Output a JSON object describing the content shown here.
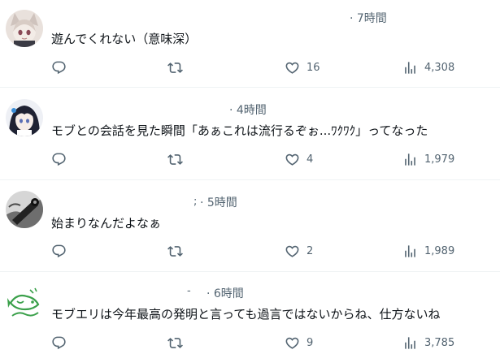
{
  "tweets": [
    {
      "time_label": "· 7時間",
      "text": "遊んでくれない（意味深）",
      "reply_count": "",
      "retweet_count": "",
      "like_count": "16",
      "view_count": "4,308",
      "avatar": "avatar-animal-ears-girl"
    },
    {
      "time_label": "· 4時間",
      "text": "モブとの会話を見た瞬間「あぁこれは流行るぞぉ...ﾜｸﾜｸ」ってなった",
      "reply_count": "",
      "retweet_count": "",
      "like_count": "4",
      "view_count": "1,979",
      "avatar": "avatar-dark-haired-girl"
    },
    {
      "time_label": "· 5時間",
      "text": "始まりなんだよなぁ",
      "reply_count": "",
      "retweet_count": "",
      "like_count": "2",
      "view_count": "1,989",
      "avatar": "avatar-monochrome-photo"
    },
    {
      "time_label": "· 6時間",
      "text": "モブエリは今年最高の発明と言っても過言ではないからね、仕方ないね",
      "reply_count": "",
      "retweet_count": "",
      "like_count": "9",
      "view_count": "3,785",
      "avatar": "avatar-green-fish-logo"
    }
  ],
  "name_fragments": [
    ";",
    "-"
  ],
  "icons": {
    "reply": "reply-icon",
    "retweet": "retweet-icon",
    "like": "heart-icon",
    "views": "views-chart-icon"
  },
  "colors": {
    "text": "#0f1419",
    "secondary": "#536471",
    "divider": "#eff3f4"
  }
}
